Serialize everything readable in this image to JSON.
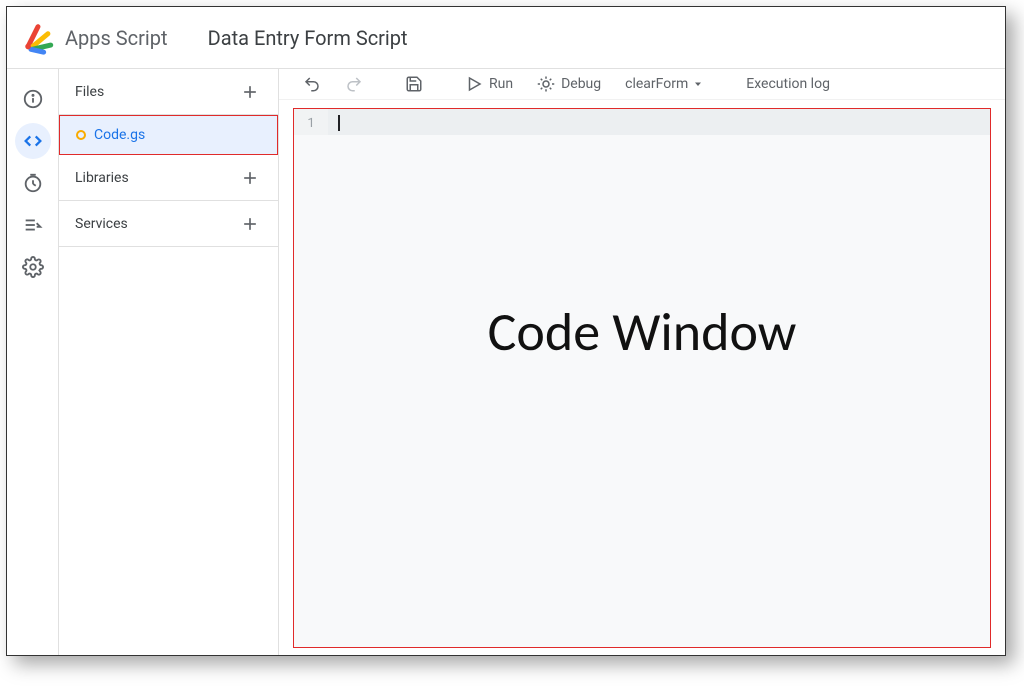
{
  "header": {
    "app_name": "Apps Script",
    "project_title": "Data Entry Form Script"
  },
  "rail": {
    "items": [
      {
        "name": "overview",
        "icon": "info"
      },
      {
        "name": "editor",
        "icon": "code",
        "active": true
      },
      {
        "name": "triggers",
        "icon": "clock"
      },
      {
        "name": "executions",
        "icon": "list"
      },
      {
        "name": "settings",
        "icon": "gear"
      }
    ]
  },
  "sidebar": {
    "sections": {
      "files_label": "Files",
      "libraries_label": "Libraries",
      "services_label": "Services"
    },
    "files": [
      {
        "name": "Code.gs",
        "unsaved": true,
        "selected": true
      }
    ]
  },
  "toolbar": {
    "run_label": "Run",
    "debug_label": "Debug",
    "function_selected": "clearForm",
    "execution_log_label": "Execution log"
  },
  "editor": {
    "line_number": "1",
    "content": "",
    "annotation_overlay": "Code Window"
  }
}
